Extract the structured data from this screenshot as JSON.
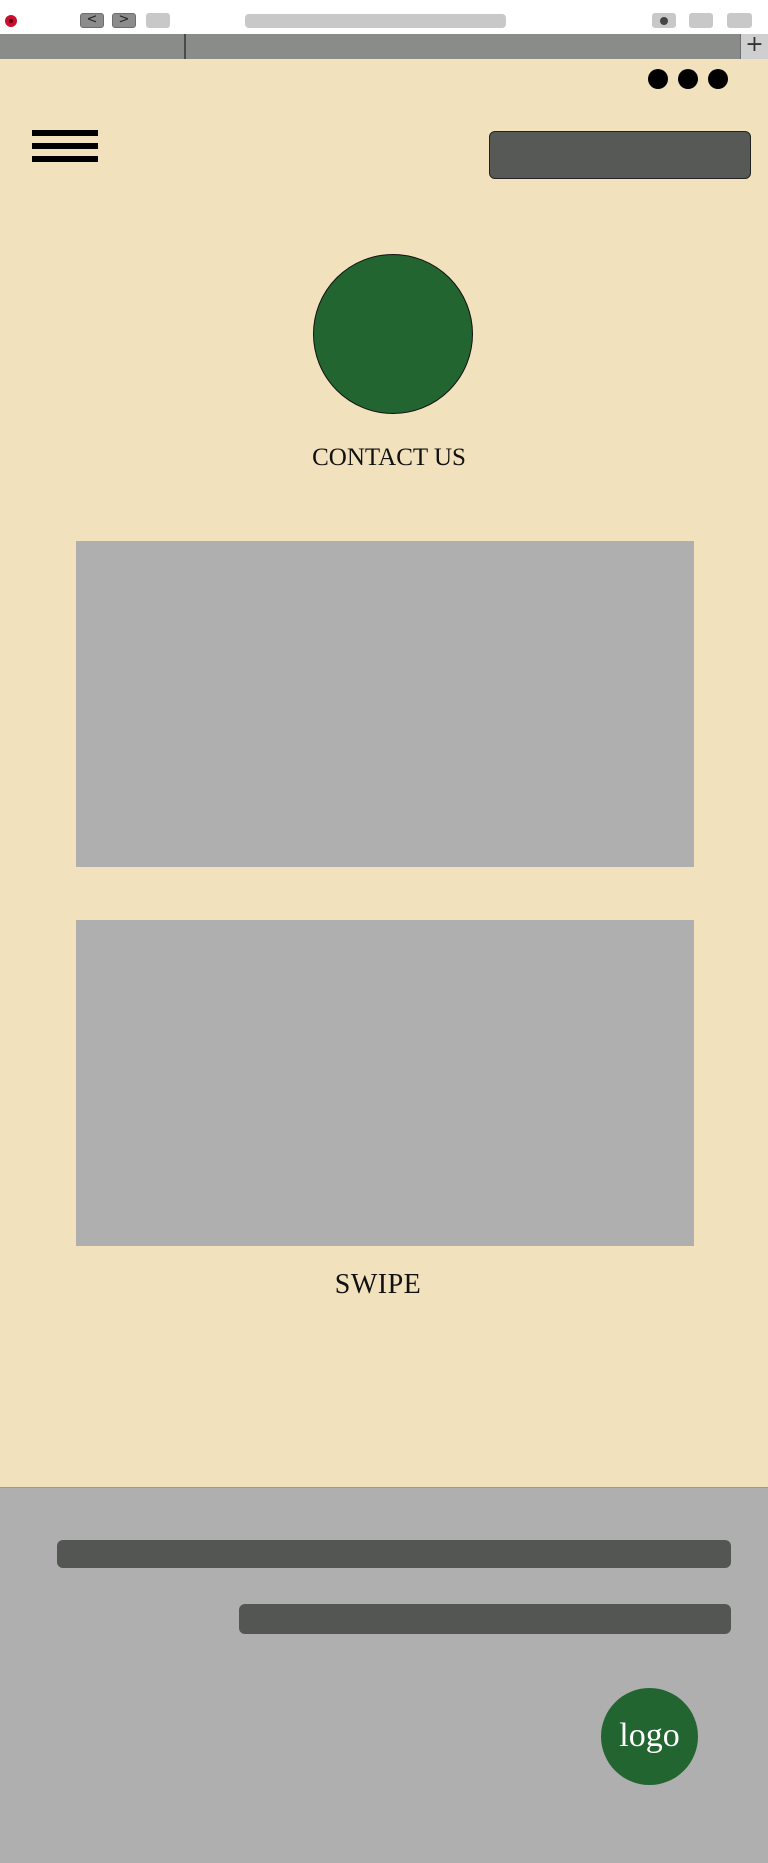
{
  "browser": {
    "back_label": "<",
    "forward_label": ">",
    "new_tab_label": "+"
  },
  "page": {
    "title": "CONTACT US",
    "swipe_label": "SWIPE"
  },
  "footer": {
    "logo_text": "logo"
  },
  "colors": {
    "page_background": "#f1e1bd",
    "accent_green": "#236531",
    "dark_gray": "#575957",
    "placeholder_gray": "#afafaf"
  }
}
